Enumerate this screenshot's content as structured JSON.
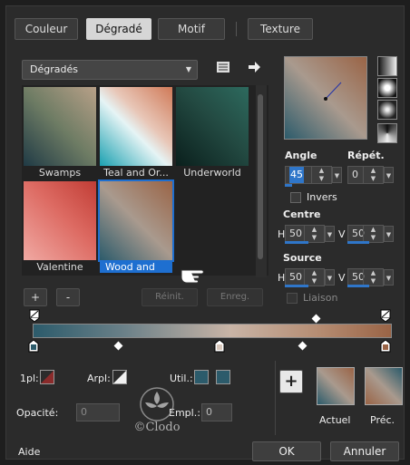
{
  "tabs": [
    {
      "label": "Couleur"
    },
    {
      "label": "Dégradé"
    },
    {
      "label": "Motif"
    },
    {
      "label": "Texture"
    }
  ],
  "category": {
    "selected": "Dégradés"
  },
  "gradients": [
    {
      "label": "Swamps"
    },
    {
      "label": "Teal and Or..."
    },
    {
      "label": "Underworld"
    },
    {
      "label": "Valentine"
    },
    {
      "label": "Wood and"
    }
  ],
  "gallery_buttons": {
    "add": "+",
    "remove": "-",
    "reset": "Réinit.",
    "save": "Enreg."
  },
  "angle": {
    "label": "Angle",
    "value": "45"
  },
  "repeat": {
    "label": "Répét.",
    "value": "0"
  },
  "invert": {
    "label": "Invers"
  },
  "center": {
    "label": "Centre",
    "h_label": "H",
    "h_value": "50",
    "v_label": "V",
    "v_value": "50"
  },
  "source": {
    "label": "Source",
    "h_label": "H",
    "h_value": "50",
    "v_label": "V",
    "v_value": "50"
  },
  "link": {
    "label": "Liaison"
  },
  "stops": {
    "opacity_label": "Opacité:",
    "opacity_value": "0",
    "location_label": "Empl.:",
    "location_value": "0",
    "first_label": "1pl:",
    "arpl_label": "Arpl:",
    "util_label": "Util.:"
  },
  "swatches": {
    "current_label": "Actuel",
    "previous_label": "Préc."
  },
  "watermark": {
    "text": "©Clodo"
  },
  "footer": {
    "help": "Aide",
    "ok": "OK",
    "cancel": "Annuler"
  },
  "colors": {
    "teal": "#2c5b6b",
    "brown": "#9a6446",
    "accent": "#1e6fd0"
  }
}
